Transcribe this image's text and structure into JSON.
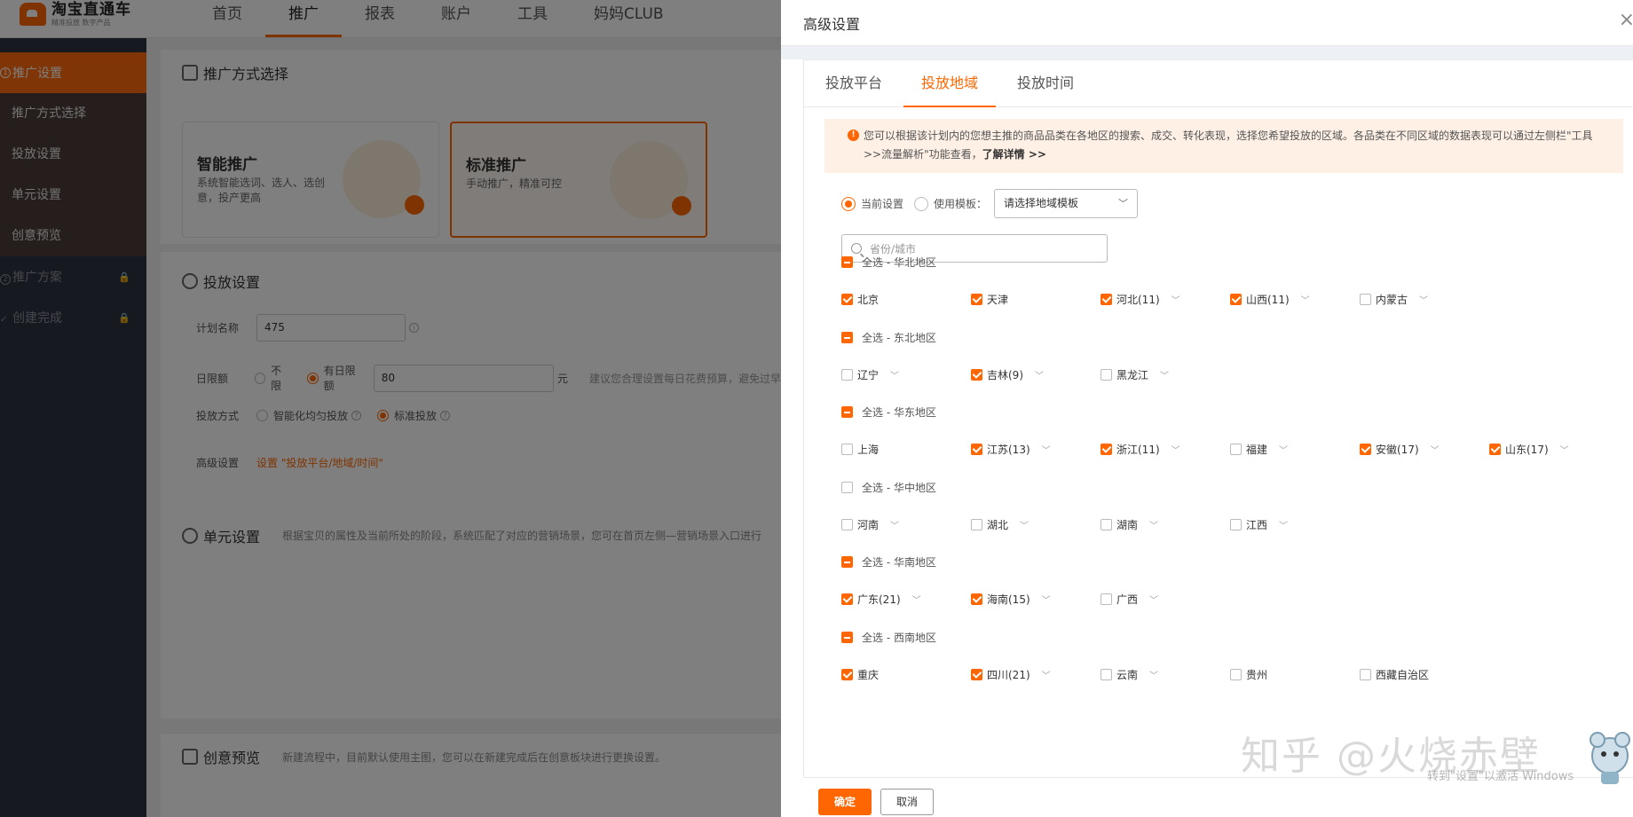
{
  "app": {
    "logo_title": "淘宝直通车",
    "logo_sub": "精准投放 数字产品"
  },
  "topnav": [
    "首页",
    "推广",
    "报表",
    "账户",
    "工具",
    "妈妈CLUB"
  ],
  "sidebar": {
    "step1_num": "1",
    "step1": "推广设置",
    "items": [
      "推广方式选择",
      "投放设置",
      "单元设置",
      "创意预览"
    ],
    "step2_num": "2",
    "step2": "推广方案",
    "step3_num": "✓",
    "step3": "创建完成"
  },
  "main": {
    "method_title": "推广方式选择",
    "smart_title": "智能推广",
    "smart_desc": "系统智能选词、选人、选创意，投产更高",
    "std_title": "标准推广",
    "std_desc": "手动推广，精准可控",
    "delivery_title": "投放设置",
    "plan_name_label": "计划名称",
    "plan_name_value": "475",
    "daily_label": "日限额",
    "daily_opt1": "不限",
    "daily_opt2": "有日限额",
    "daily_value": "80",
    "daily_unit": "元",
    "daily_hint": "建议您合理设置每日花费预算，避免过早",
    "mode_label": "投放方式",
    "mode_opt1": "智能化均匀投放",
    "mode_opt2": "标准投放",
    "adv_label": "高级设置",
    "adv_link": "设置 \"投放平台/地域/时间\"",
    "unit_title": "单元设置",
    "unit_desc": "根据宝贝的属性及当前所处的阶段，系统匹配了对应的营销场景，您可在首页左侧—营销场景入口进行",
    "creative_title": "创意预览",
    "creative_desc": "新建流程中，目前默认使用主图，您可以在新建完成后在创意板块进行更换设置。"
  },
  "drawer": {
    "title": "高级设置",
    "close": "×",
    "tabs": [
      "投放平台",
      "投放地域",
      "投放时间"
    ],
    "notice_text": "您可以根据该计划内的您想主推的商品品类在各地区的搜索、成交、转化表现，选择您希望投放的区域。各品类在不同区域的数据表现可以通过左侧栏\"工具>>流量解析\"功能查看，",
    "notice_link": "了解详情 >>",
    "mode_current": "当前设置",
    "mode_template": "使用模板：",
    "template_placeholder": "请选择地域模板",
    "search_placeholder": "省份/城市",
    "regions": [
      {
        "label": "全选 - 华北地区",
        "state": "partial",
        "items": [
          {
            "name": "北京",
            "checked": true,
            "chev": false
          },
          {
            "name": "天津",
            "checked": true,
            "chev": false
          },
          {
            "name": "河北(11)",
            "checked": true,
            "chev": true
          },
          {
            "name": "山西(11)",
            "checked": true,
            "chev": true
          },
          {
            "name": "内蒙古",
            "checked": false,
            "chev": true
          }
        ]
      },
      {
        "label": "全选 - 东北地区",
        "state": "partial",
        "items": [
          {
            "name": "辽宁",
            "checked": false,
            "chev": true
          },
          {
            "name": "吉林(9)",
            "checked": true,
            "chev": true
          },
          {
            "name": "黑龙江",
            "checked": false,
            "chev": true
          }
        ]
      },
      {
        "label": "全选 - 华东地区",
        "state": "partial",
        "items": [
          {
            "name": "上海",
            "checked": false,
            "chev": false
          },
          {
            "name": "江苏(13)",
            "checked": true,
            "chev": true
          },
          {
            "name": "浙江(11)",
            "checked": true,
            "chev": true
          },
          {
            "name": "福建",
            "checked": false,
            "chev": true
          },
          {
            "name": "安徽(17)",
            "checked": true,
            "chev": true
          },
          {
            "name": "山东(17)",
            "checked": true,
            "chev": true
          }
        ]
      },
      {
        "label": "全选 - 华中地区",
        "state": "none",
        "items": [
          {
            "name": "河南",
            "checked": false,
            "chev": true
          },
          {
            "name": "湖北",
            "checked": false,
            "chev": true
          },
          {
            "name": "湖南",
            "checked": false,
            "chev": true
          },
          {
            "name": "江西",
            "checked": false,
            "chev": true
          }
        ]
      },
      {
        "label": "全选 - 华南地区",
        "state": "partial",
        "items": [
          {
            "name": "广东(21)",
            "checked": true,
            "chev": true
          },
          {
            "name": "海南(15)",
            "checked": true,
            "chev": true
          },
          {
            "name": "广西",
            "checked": false,
            "chev": true
          }
        ]
      },
      {
        "label": "全选 - 西南地区",
        "state": "partial",
        "items": [
          {
            "name": "重庆",
            "checked": true,
            "chev": false
          },
          {
            "name": "四川(21)",
            "checked": true,
            "chev": true
          },
          {
            "name": "云南",
            "checked": false,
            "chev": true
          },
          {
            "name": "贵州",
            "checked": false,
            "chev": false
          },
          {
            "name": "西藏自治区",
            "checked": false,
            "chev": false
          }
        ]
      }
    ],
    "ok": "确定",
    "cancel": "取消"
  },
  "watermark": "知乎 @火烧赤壁",
  "win_hint": "转到\"设置\"以激活 Windows",
  "colors": {
    "accent": "#ff6600",
    "sidebar": "#2d3240"
  }
}
